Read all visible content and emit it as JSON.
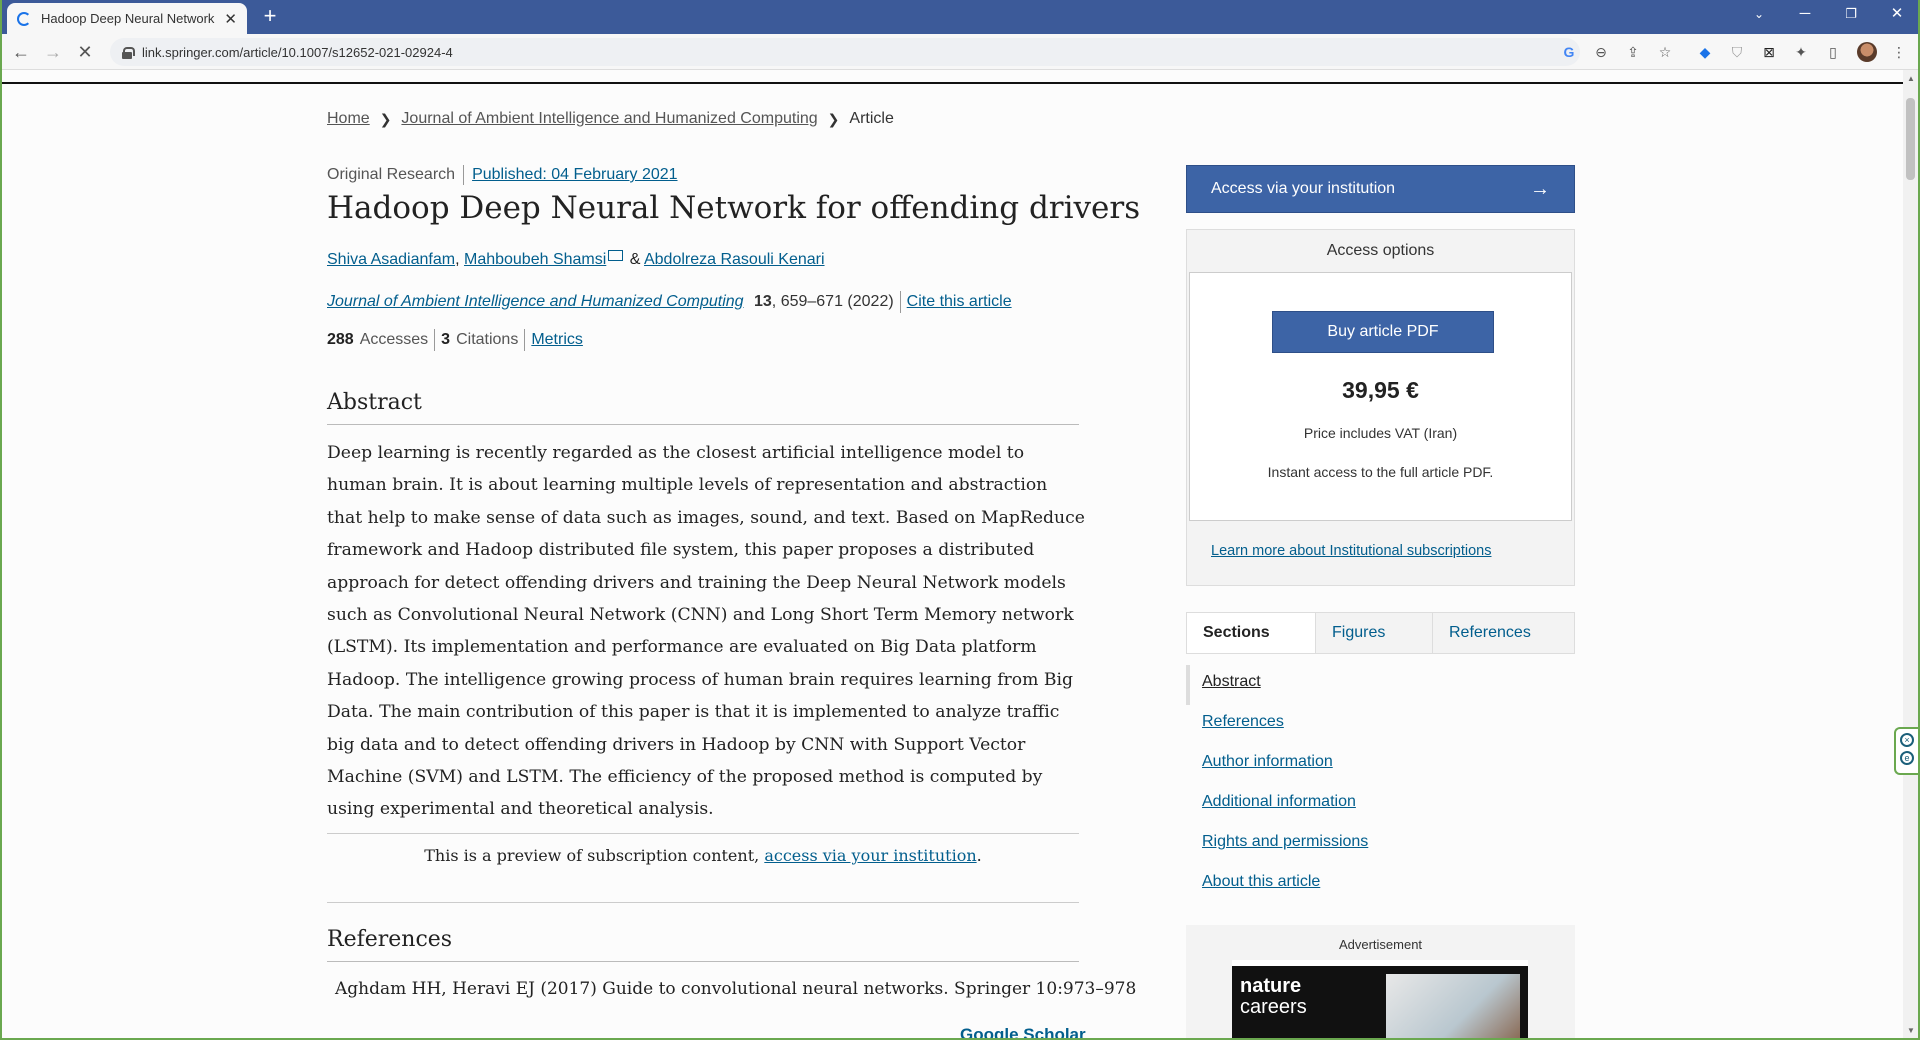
{
  "browser": {
    "tab_title": "Hadoop Deep Neural Network fo",
    "new_tab_icon": "plus-icon",
    "url": "link.springer.com/article/10.1007/s12652-021-02924-4"
  },
  "breadcrumb": {
    "home": "Home",
    "journal": "Journal of Ambient Intelligence and Humanized Computing",
    "current": "Article"
  },
  "article": {
    "type": "Original Research",
    "published": "Published: 04 February 2021",
    "title": "Hadoop Deep Neural Network for offending drivers",
    "authors": {
      "a1": "Shiva Asadianfam",
      "comma": ",",
      "a2": "Mahboubeh Shamsi",
      "amp": "&",
      "a3": "Abdolreza Rasouli Kenari"
    },
    "journal_name": "Journal of Ambient Intelligence and Humanized Computing",
    "volume": "13",
    "pages_year": ", 659–671 (2022)",
    "cite": "Cite this article",
    "accesses_count": "288",
    "accesses_label": "Accesses",
    "citations_count": "3",
    "citations_label": "Citations",
    "metrics": "Metrics"
  },
  "abstract": {
    "heading": "Abstract",
    "text": "Deep learning is recently regarded as the closest artificial intelligence model to human brain. It is about learning multiple levels of representation and abstraction that help to make sense of data such as images, sound, and text. Based on MapReduce framework and Hadoop distributed file system, this paper proposes a distributed approach for detect offending drivers and training the Deep Neural Network models such as Convolutional Neural Network (CNN) and Long Short Term Memory network (LSTM). Its implementation and performance are evaluated on Big Data platform Hadoop. The intelligence growing process of human brain requires learning from Big Data. The main contribution of this paper is that it is implemented to analyze traffic big data and to detect offending drivers in Hadoop by CNN with Support Vector Machine (SVM) and LSTM. The efficiency of the proposed method is computed by using experimental and theoretical analysis."
  },
  "preview": {
    "text": "This is a preview of subscription content,",
    "link": "access via your institution",
    "end": "."
  },
  "references": {
    "heading": "References",
    "first": "Aghdam HH, Heravi EJ (2017) Guide to convolutional neural networks. Springer 10:973–978",
    "google_scholar": "Google Scholar"
  },
  "sidebar": {
    "access_institution": "Access via your institution",
    "arrow": "→",
    "access_options": "Access options",
    "buy_pdf": "Buy article PDF",
    "price": "39,95 €",
    "vat": "Price includes VAT (Iran)",
    "instant": "Instant access to the full article PDF.",
    "learn_more": "Learn more about Institutional subscriptions",
    "tabs": [
      "Sections",
      "Figures",
      "References"
    ],
    "sections": [
      "Abstract",
      "References",
      "Author information",
      "Additional information",
      "Rights and permissions",
      "About this article"
    ],
    "advertisement": "Advertisement",
    "ad_brand1": "nature",
    "ad_brand2": "careers"
  },
  "colors": {
    "link": "#025e8d",
    "button": "#3d64a6",
    "tabbar": "#3c5a99"
  }
}
